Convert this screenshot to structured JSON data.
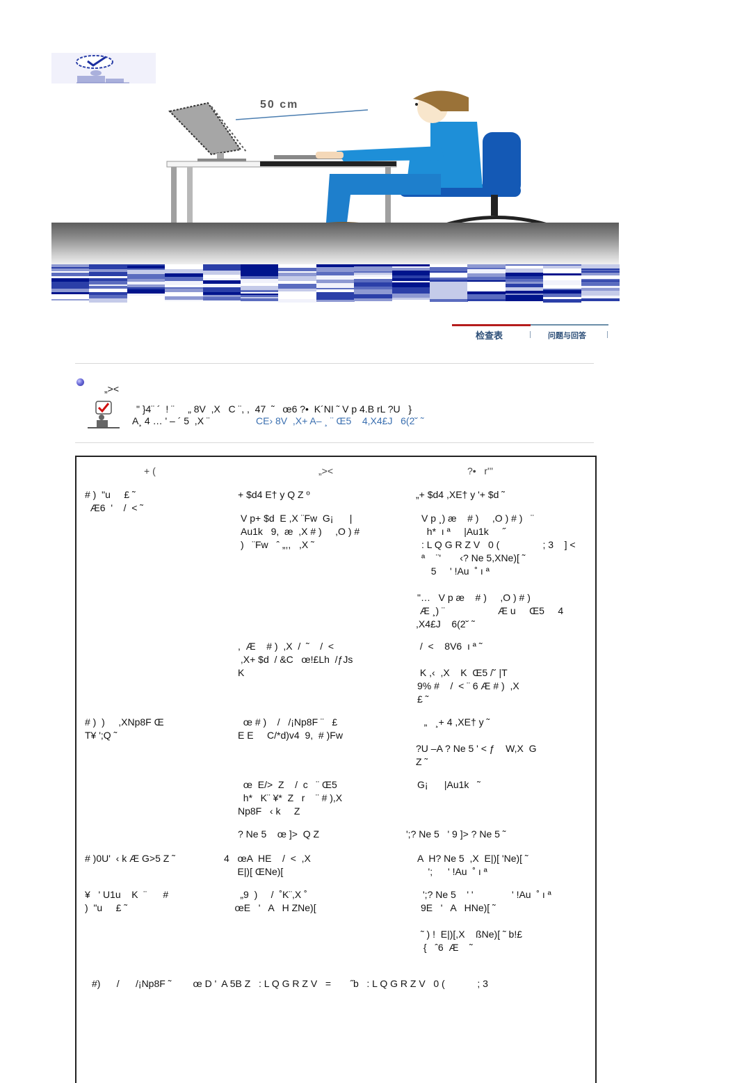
{
  "header": {
    "icon": "checklist-person-icon",
    "illustration": {
      "label": "50 cm",
      "description": "person sitting at desk facing monitor"
    }
  },
  "tabs": [
    {
      "label": "检查表",
      "active": true
    },
    {
      "label": "问题与回答",
      "active": false
    }
  ],
  "colors": {
    "tab_active": "#b51d1d",
    "tab_text": "#2d4f78",
    "link_blue": "#3a6fb0",
    "link_violet": "#6a6ae0",
    "stripe_dark": "#00148c",
    "stripe_mid": "#2b3fa8"
  },
  "intro": {
    "heading": "„><",
    "line1": "\" }4¨ ´  ! ¨     „ 8V  ,X   C ¨, ,  47  ˜   œ6 ?•  K´NI ˜ V p 4.B rL ?U   }",
    "line2_plain": "A¸ 4 … ' – ´ 5  ,X ¨",
    "line2_link": "CE› 8V  ,X+ A– ¸ ¨ Œ5    4,X4£J   6(2˘ ˜"
  },
  "table": {
    "headers": [
      "+ (",
      "„><",
      "?•   r'''"
    ],
    "rows": [
      {
        "symptom": "# )  \"u     £ ˜\n  Æ6  '    /  < ˜",
        "checks": [
          {
            "check": "+ $d4 E† y Q Z º",
            "solution": "„+ $d4 ,XE† y '+ $d ˜"
          },
          {
            "check": "V p+ $d  E ,X ¨Fw  G¡      |\nAu1k   9,  æ  ,X # )     ,O ) #\n)   ¨Fw   ˆ „,,   ,X ˜",
            "solution": "V p ¸) æ    # )     ,O ) # )   ¨\n  h*  ı ª     |Au1k     ˝\n: L Q G R Z V   0 (                ; 3    ] <\nª    ¨'       ‹? Ne 5,XNe)[ ˜",
            "solution_link": "  5     ' !Au  ˚ ı ª"
          },
          {
            "check": "",
            "solution": "\"…   V p æ    # )     ,O ) # )",
            "solution2_plain": " Æ ¸) ¨       ",
            "solution2_link": "Æ u     Œ5     4\n,X4£J    6(2˘ ˜"
          },
          {
            "check": ",  Æ    # )  ,X  /  ˜    /  <\n ,X+ $d  / &C   œ!£Lh  /ƒJs\nK",
            "solution": " /  <    8V6  ı ª ˜\n\n K ,‹  ,X    K  Œ5 /˘ |T\n9% #    /  < ¨ 6 Æ # )  ,X\n£ ˜"
          }
        ]
      },
      {
        "symptom": "# )  )     ,XNp8F Œ\nT¥ ';Q ˜",
        "checks": [
          {
            "check": "  œ # )    /   /¡Np8F ¨   £\nE E     C/*d)v4  9,  # )Fw",
            "solution": "   „   ¸+ 4 ,XE† y ˜\n\n?U –A ? Ne 5 ' < ƒ    W,X  G\nZ ˜"
          },
          {
            "check": "  œ  E/>  Z    /  c   ¨ Œ5\n  h*   K¨ ¥*  Z   r    ¨ # ),X\nNp8F   ‹ k     Z",
            "solution": "G¡      |Au1k   ˜"
          },
          {
            "check": "? Ne 5    œ ]>  Q Z",
            "solution": "';? Ne 5   ' 9 ]> ? Ne 5 ˜"
          }
        ]
      },
      {
        "symptom": "# )0U'  ‹ k Æ G>5 Z ˜",
        "checks": [
          {
            "check": "4   œA  HE    /  <  ,X\n     E|)[ ŒNe)[",
            "solution": "A  H? Ne 5  ,X  E|)[ 'Ne)[ ˜",
            "solution_link_prefix": "    ';   ",
            "solution_link": "' !Au  ˚ ı ª"
          }
        ]
      },
      {
        "symptom": "¥   ' U1u    K  ¨      #\n)  \"u     £ ˜",
        "checks": [
          {
            "check": "      „9  )     /  ˚K¨,X ˚\n    œE   '   A   H ZNe)[",
            "solution": "';? Ne 5    ' '          ",
            "solution_link": "' !Au  ˚ ı ª",
            "solution_line2": "9E   '   A   HNe)[ ˜",
            "solution_extra": "˜ ) !  E|)[,X    ßNe)[ ˜ b!£\n {   ˆ6  Æ    ˜"
          }
        ]
      }
    ],
    "footer": "#)      /      /¡Np8F ˜        œ D '  A 5B Z   : L Q G R Z V   =       ˝b   : L Q G R Z V   0 (            ; 3"
  }
}
